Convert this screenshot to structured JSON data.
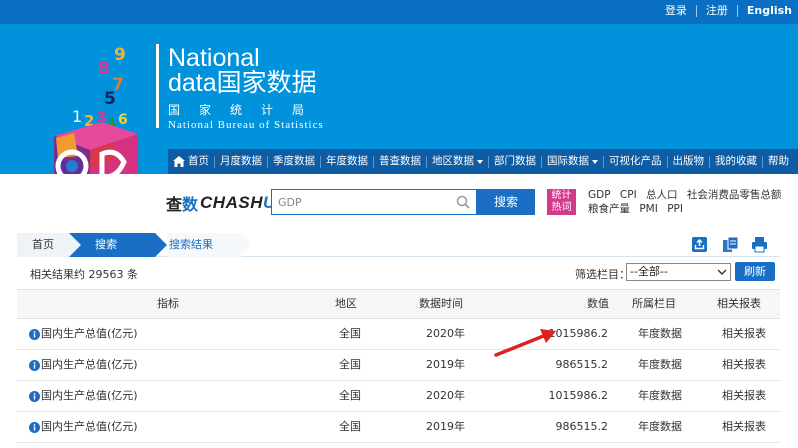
{
  "top_links": {
    "login": "登录",
    "register": "注册",
    "english": "English"
  },
  "brand": {
    "national": "National",
    "data_prefix": "data",
    "data_cn": "国家数据",
    "bureau_cn": "国家统计局",
    "bureau_en": "National Bureau of Statistics",
    "cube_digits": [
      "9",
      "8",
      "7",
      "5",
      "1",
      "2",
      "3",
      "4",
      "6"
    ]
  },
  "nav": {
    "items": [
      {
        "label": "首页",
        "has_icon": true
      },
      {
        "label": "月度数据"
      },
      {
        "label": "季度数据"
      },
      {
        "label": "年度数据"
      },
      {
        "label": "普查数据"
      },
      {
        "label": "地区数据",
        "dropdown": true
      },
      {
        "label": "部门数据"
      },
      {
        "label": "国际数据",
        "dropdown": true
      },
      {
        "label": "可视化产品"
      },
      {
        "label": "出版物"
      },
      {
        "label": "我的收藏"
      },
      {
        "label": "帮助"
      }
    ]
  },
  "search": {
    "logo_cn_a": "查",
    "logo_cn_b": "数",
    "logo_en_a": "CHASH",
    "logo_en_b": "U",
    "input_value": "GDP",
    "button_label": "搜索",
    "hot_badge_line1": "统计",
    "hot_badge_line2": "热词",
    "hot_words": [
      "GDP",
      "CPI",
      "总人口",
      "社会消费品零售总额",
      "粮食产量",
      "PMI",
      "PPI"
    ]
  },
  "breadcrumb": {
    "home": "首页",
    "search": "搜索",
    "result": "搜索结果"
  },
  "results": {
    "count_text": "相关结果约 29563 条",
    "filter_label": "筛选栏目：",
    "filter_selected": "--全部--",
    "refresh_label": "刷新"
  },
  "table": {
    "headers": {
      "indicator": "指标",
      "region": "地区",
      "time": "数据时间",
      "value": "数值",
      "column": "所属栏目",
      "report": "相关报表"
    },
    "rows": [
      {
        "indicator": "国内生产总值(亿元)",
        "region": "全国",
        "time": "2020年",
        "value": "1015986.2",
        "column": "年度数据",
        "report": "相关报表"
      },
      {
        "indicator": "国内生产总值(亿元)",
        "region": "全国",
        "time": "2019年",
        "value": "986515.2",
        "column": "年度数据",
        "report": "相关报表"
      },
      {
        "indicator": "国内生产总值(亿元)",
        "region": "全国",
        "time": "2020年",
        "value": "1015986.2",
        "column": "年度数据",
        "report": "相关报表"
      },
      {
        "indicator": "国内生产总值(亿元)",
        "region": "全国",
        "time": "2019年",
        "value": "986515.2",
        "column": "年度数据",
        "report": "相关报表"
      }
    ]
  },
  "colors": {
    "top_bar": "#0a6ec2",
    "banner": "#0093dc",
    "nav": "#0d5ca4",
    "accent": "#1a6fc4",
    "hot_badge": "#d43a8b",
    "annotation_arrow": "#e02020"
  }
}
